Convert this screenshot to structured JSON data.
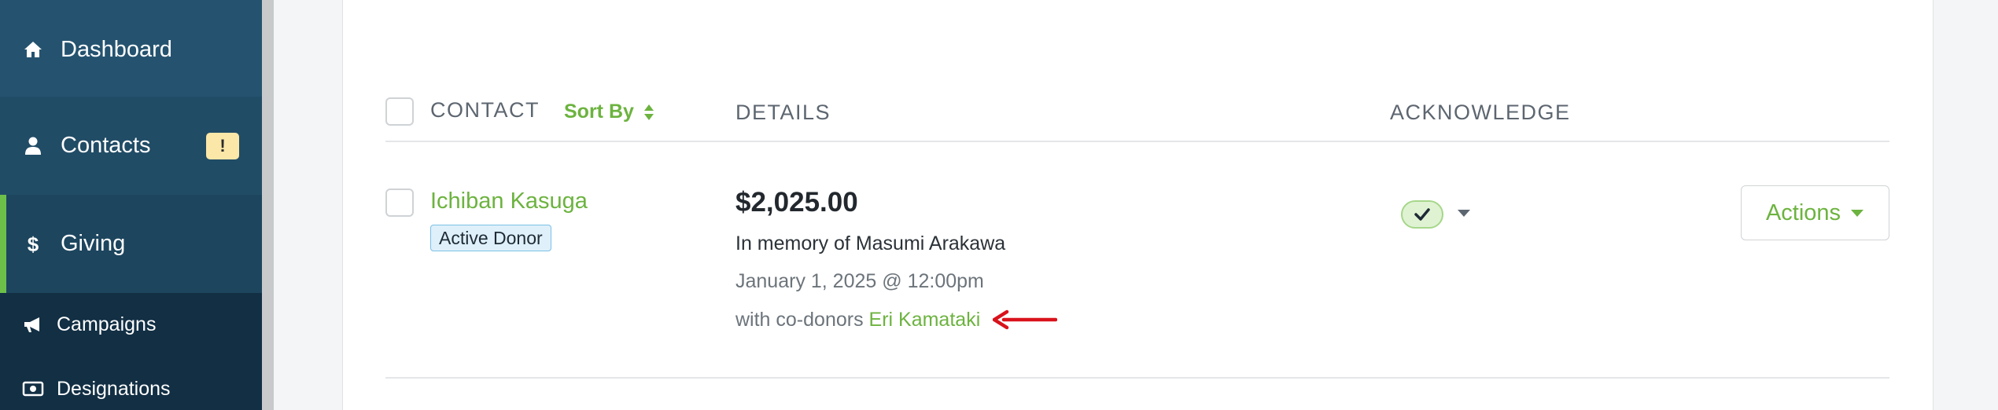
{
  "sidebar": {
    "dashboard_label": "Dashboard",
    "contacts_label": "Contacts",
    "contacts_badge": "!",
    "giving_label": "Giving",
    "sub_items": [
      {
        "label": "Campaigns",
        "icon": "megaphone-icon"
      },
      {
        "label": "Designations",
        "icon": "money-icon"
      }
    ]
  },
  "table": {
    "headers": {
      "contact": "CONTACT",
      "sort_by": "Sort By",
      "details": "DETAILS",
      "acknowledge": "ACKNOWLEDGE"
    },
    "rows": [
      {
        "contact_name": "Ichiban Kasuga",
        "donor_status": "Active Donor",
        "amount": "$2,025.00",
        "memory": "In memory of Masumi Arakawa",
        "date": "January 1, 2025 @ 12:00pm",
        "codonors_prefix": "with co-donors",
        "codonor_name": "Eri Kamataki",
        "acknowledged": true,
        "actions_label": "Actions"
      }
    ]
  },
  "colors": {
    "sidebar_bg": "#1c3d55",
    "accent_green": "#6cb33f",
    "annotation_red": "#d9121b",
    "badge_blue_bg": "#dff0fb"
  }
}
